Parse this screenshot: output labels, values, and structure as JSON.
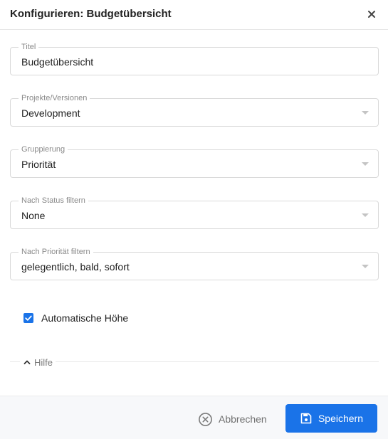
{
  "dialog": {
    "title": "Konfigurieren: Budgetübersicht"
  },
  "fields": {
    "title": {
      "label": "Titel",
      "value": "Budgetübersicht"
    },
    "projects": {
      "label": "Projekte/Versionen",
      "value": "Development"
    },
    "grouping": {
      "label": "Gruppierung",
      "value": "Priorität"
    },
    "status_filter": {
      "label": "Nach Status filtern",
      "value": "None"
    },
    "priority_filter": {
      "label": "Nach Priorität filtern",
      "value": "gelegentlich, bald, sofort"
    }
  },
  "auto_height": {
    "label": "Automatische Höhe",
    "checked": true
  },
  "help": {
    "label": "Hilfe"
  },
  "footer": {
    "cancel_label": "Abbrechen",
    "save_label": "Speichern"
  },
  "colors": {
    "accent": "#1a73e8",
    "footer_bg": "#f7f8fa",
    "border": "#d9d9d9"
  }
}
